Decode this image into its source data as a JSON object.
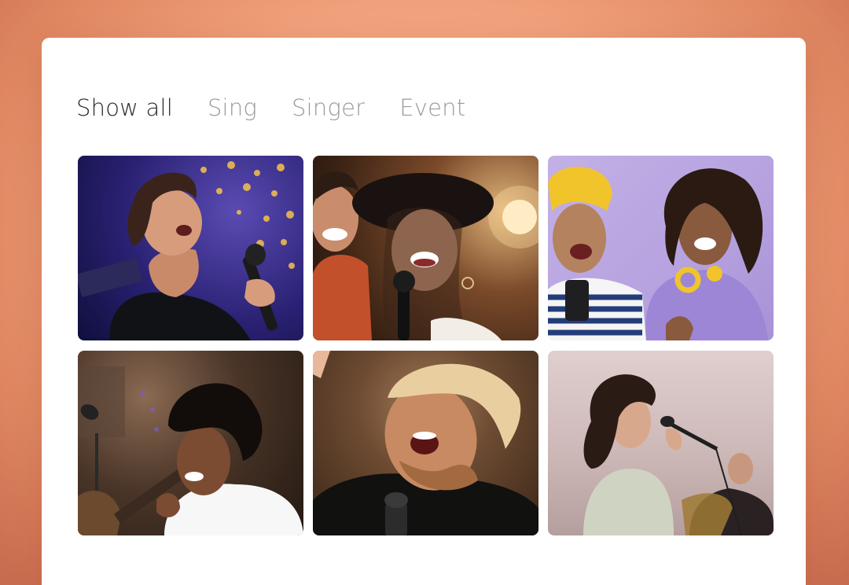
{
  "tabs": [
    {
      "label": "Show all",
      "active": true
    },
    {
      "label": "Sing",
      "active": false
    },
    {
      "label": "Singer",
      "active": false
    },
    {
      "label": "Event",
      "active": false
    }
  ],
  "gallery": [
    {
      "subject": "woman singing into microphone on stage with bokeh lights"
    },
    {
      "subject": "man and woman in hat singing together under warm stage light"
    },
    {
      "subject": "man in yellow beanie and woman with headphones singing"
    },
    {
      "subject": "man with guitar laughing beside microphone"
    },
    {
      "subject": "man singing with head tilted back at microphone"
    },
    {
      "subject": "curly-haired woman singing into microphone at event"
    }
  ],
  "colors": {
    "background": "#f1a27c",
    "card": "#ffffff",
    "tab_active": "#2a2a2a",
    "tab_inactive": "#9a9a9a"
  }
}
